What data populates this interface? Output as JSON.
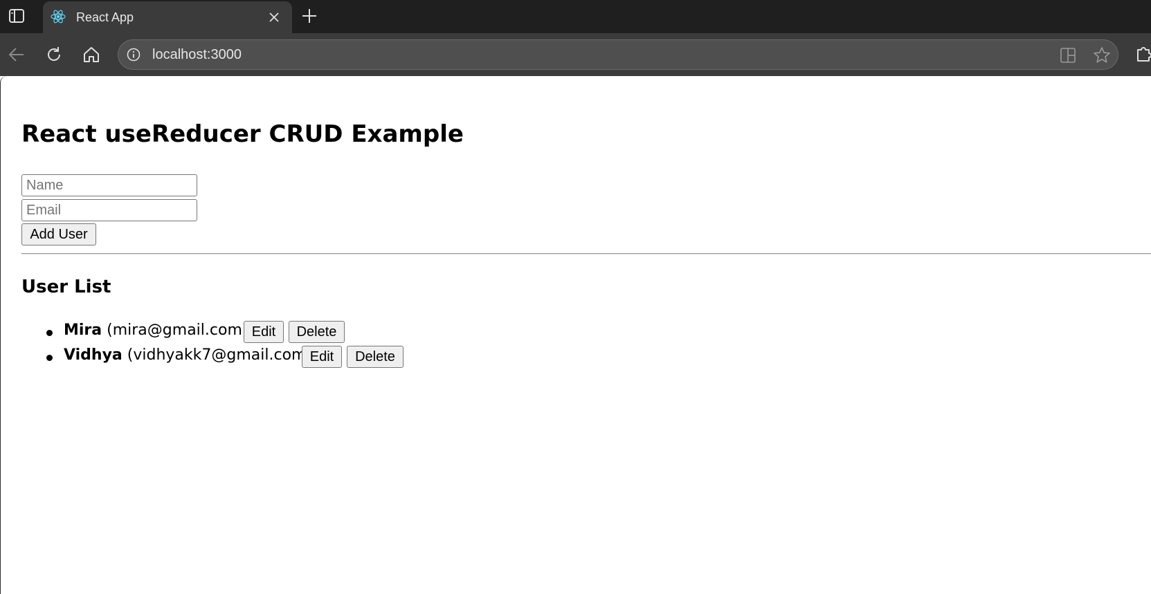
{
  "browser": {
    "tab": {
      "title": "React App",
      "favicon": "react-logo-icon"
    },
    "address_bar": {
      "url": "localhost:3000"
    },
    "icons": {
      "sidebar": "sidebar-toggle-icon",
      "close_tab": "close-icon",
      "new_tab": "plus-icon",
      "back": "arrow-left-icon",
      "reload": "reload-icon",
      "home": "home-icon",
      "site_info": "info-icon",
      "split": "split-screen-icon",
      "favorite": "star-icon",
      "extensions": "puzzle-icon"
    },
    "colors": {
      "tabbar": "#1f1f1f",
      "toolbar": "#3b3b3b",
      "omnibox": "#4f4f4f",
      "react_accent": "#61dafb"
    }
  },
  "page": {
    "title": "React useReducer CRUD Example",
    "form": {
      "name_placeholder": "Name",
      "name_value": "",
      "email_placeholder": "Email",
      "email_value": "",
      "add_button_label": "Add User"
    },
    "user_list": {
      "heading": "User List",
      "users": [
        {
          "name": "Mira",
          "email_display": "(mira@gmail.com)",
          "edit_label": "Edit",
          "delete_label": "Delete"
        },
        {
          "name": "Vidhya",
          "email_display": "(vidhyakk7@gmail.com)",
          "edit_label": "Edit",
          "delete_label": "Delete"
        }
      ]
    }
  }
}
